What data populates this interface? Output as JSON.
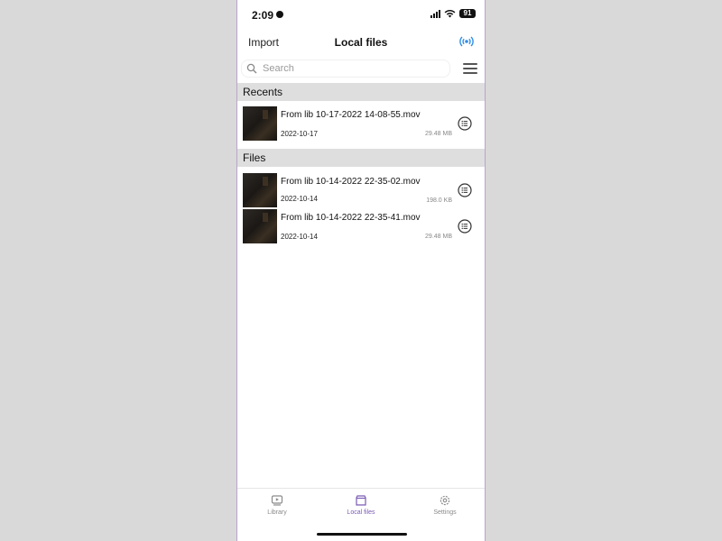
{
  "status_bar": {
    "time": "2:09",
    "battery": "91"
  },
  "nav": {
    "left": "Import",
    "title": "Local files"
  },
  "search": {
    "placeholder": "Search"
  },
  "sections": {
    "recents": {
      "title": "Recents",
      "items": [
        {
          "name": "From lib 10-17-2022 14-08-55.mov",
          "date": "2022-10-17",
          "size": "29.48 MB"
        }
      ]
    },
    "files": {
      "title": "Files",
      "items": [
        {
          "name": "From lib 10-14-2022 22-35-02.mov",
          "date": "2022-10-14",
          "size": "198.0 KB"
        },
        {
          "name": "From lib 10-14-2022 22-35-41.mov",
          "date": "2022-10-14",
          "size": "29.48 MB"
        }
      ]
    }
  },
  "tabs": [
    {
      "label": "Library",
      "icon": "library-icon",
      "active": false
    },
    {
      "label": "Local files",
      "icon": "folder-icon",
      "active": true
    },
    {
      "label": "Settings",
      "icon": "gear-icon",
      "active": false
    }
  ],
  "colors": {
    "accent": "#7b5bb3",
    "cast": "#2f8ee8",
    "section_bg": "#dedede"
  }
}
